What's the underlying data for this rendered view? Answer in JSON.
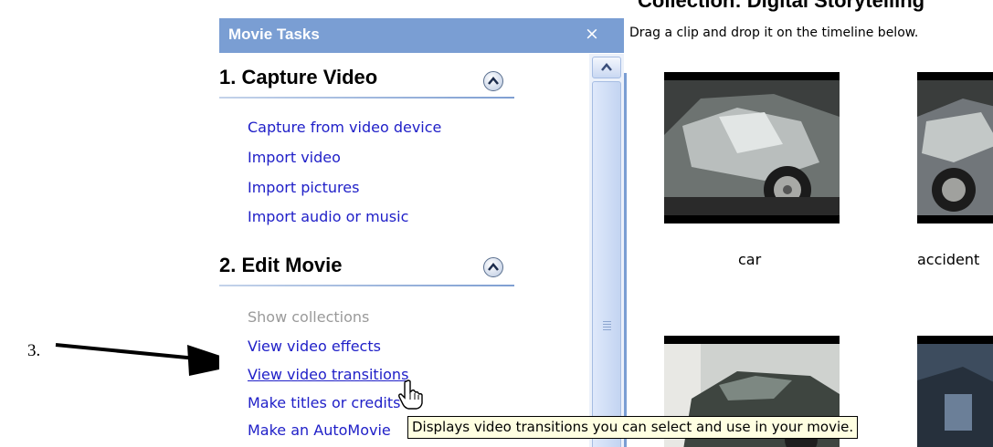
{
  "annotation": {
    "step_number": "3."
  },
  "tasks_pane": {
    "title": "Movie Tasks",
    "close_symbol": "×",
    "sections": [
      {
        "title": "1. Capture Video",
        "links": [
          "Capture from video device",
          "Import video",
          "Import pictures",
          "Import audio or music"
        ]
      },
      {
        "title": "2. Edit Movie",
        "links": [
          "Show collections",
          "View video effects",
          "View video transitions",
          "Make titles or credits",
          "Make an AutoMovie"
        ]
      }
    ],
    "link_states": {
      "disabled": "Show collections",
      "hovered": "View video transitions"
    }
  },
  "collection": {
    "title": "Collection: Digital Storytelling",
    "instructions": "Drag a clip and drop it on the timeline below.",
    "clips": [
      {
        "label": "car"
      },
      {
        "label": "accident"
      },
      {
        "label": ""
      },
      {
        "label": ""
      }
    ]
  },
  "tooltip": {
    "text": "Displays video transitions you can select and use in your movie."
  },
  "icons": {
    "collapse": "chevron-up-icon",
    "scroll_up": "arrow-up-icon",
    "cursor": "hand-pointer-icon",
    "annotation": "arrow-right-icon"
  },
  "colors": {
    "pane_header": "#7a9ed3",
    "link": "#2020c8",
    "disabled_link": "#9a9a9a",
    "tooltip_bg": "#ffffe1"
  }
}
